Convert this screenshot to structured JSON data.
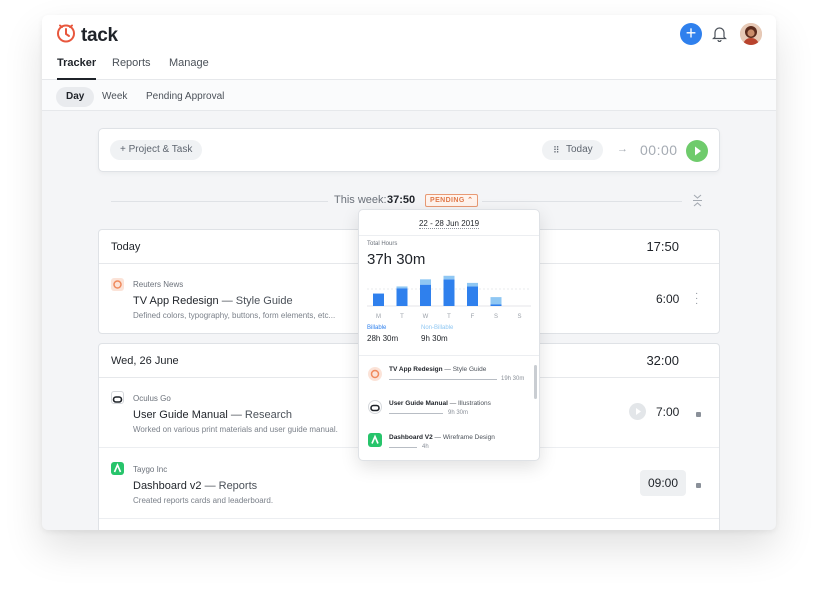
{
  "app": {
    "name": "tack"
  },
  "nav": {
    "tabs": [
      {
        "label": "Tracker"
      },
      {
        "label": "Reports"
      },
      {
        "label": "Manage"
      }
    ],
    "subtabs": [
      {
        "label": "Day"
      },
      {
        "label": "Week"
      },
      {
        "label": "Pending Approval"
      }
    ]
  },
  "entry": {
    "project_placeholder": "+ Project & Task",
    "date": "Today",
    "arrow": "→",
    "timer": "00:00"
  },
  "week": {
    "label": "This week:",
    "total": "37:50",
    "status": "PENDING"
  },
  "days": [
    {
      "title": "Today",
      "total": "17:50",
      "entries": [
        {
          "client": "Reuters News",
          "task": "TV App Redesign",
          "sub": "Style Guide",
          "desc": "Defined colors, typography, buttons, form elements, etc...",
          "duration": "6:00"
        }
      ]
    },
    {
      "title": "Wed, 26 June",
      "total": "32:00",
      "entries": [
        {
          "client": "Oculus Go",
          "task": "User Guide Manual",
          "sub": "Research",
          "desc": "Worked on various print materials and user guide manual.",
          "duration": "7:00"
        },
        {
          "client": "Taygo Inc",
          "task": "Dashboard v2",
          "sub": "Reports",
          "desc": "Created reports cards and leaderboard.",
          "duration": "09:00"
        }
      ]
    }
  ],
  "popup": {
    "range": "22 - 28 Jun 2019",
    "total_label": "Total Hours",
    "total": "37h 30m",
    "days": [
      "M",
      "T",
      "W",
      "T",
      "F",
      "S",
      "S"
    ],
    "billable_label": "Billable",
    "billable": "28h 30m",
    "nonbillable_label": "Non-Billable",
    "nonbillable": "9h 30m",
    "projects": [
      {
        "task": "TV App Redesign",
        "sub": "Style Guide",
        "hours": "19h 30m"
      },
      {
        "task": "User Guide Manual",
        "sub": "Illustrations",
        "hours": "9h 30m"
      },
      {
        "task": "Dashboard V2",
        "sub": "Wireframe Design",
        "hours": "4h"
      }
    ]
  },
  "colors": {
    "accent": "#2f80ed",
    "play": "#6fcb6c",
    "pending": "#e07a4b",
    "billable": "#2f80ed",
    "nonbillable": "#8fc7f3"
  },
  "chart_data": {
    "type": "bar",
    "categories": [
      "M",
      "T",
      "W",
      "T",
      "F",
      "S",
      "S"
    ],
    "series": [
      {
        "name": "Billable",
        "values": [
          3.5,
          5,
          6,
          7.5,
          5.5,
          0.5,
          0
        ]
      },
      {
        "name": "Non-Billable",
        "values": [
          0,
          0.5,
          1.5,
          1,
          1,
          2,
          0
        ]
      }
    ],
    "ylim": [
      0,
      9
    ]
  }
}
